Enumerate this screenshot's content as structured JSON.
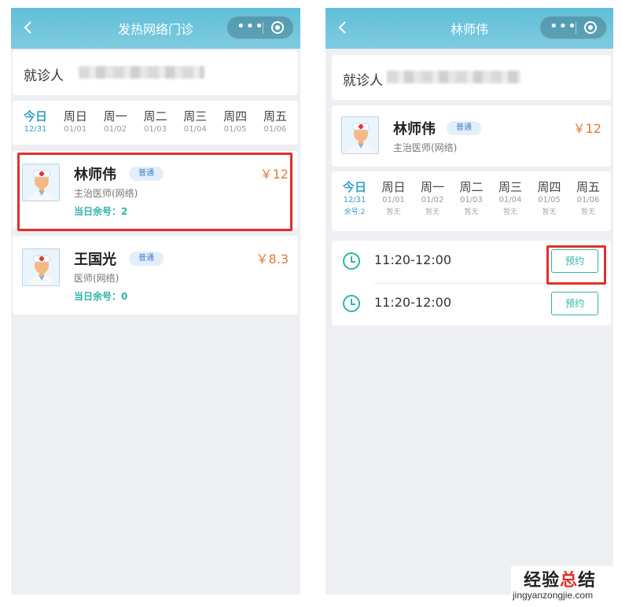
{
  "left": {
    "header": {
      "title": "发热网络门诊",
      "more_label": "•••"
    },
    "patient": {
      "label": "就诊人"
    },
    "dates": [
      {
        "day": "今日",
        "date": "12/31"
      },
      {
        "day": "周日",
        "date": "01/01"
      },
      {
        "day": "周一",
        "date": "01/02"
      },
      {
        "day": "周二",
        "date": "01/03"
      },
      {
        "day": "周三",
        "date": "01/04"
      },
      {
        "day": "周四",
        "date": "01/05"
      },
      {
        "day": "周五",
        "date": "01/06"
      }
    ],
    "doctors": [
      {
        "name": "林师伟",
        "badge": "普通",
        "title": "主治医师(网络)",
        "remaining": "当日余号：2",
        "price": "￥12"
      },
      {
        "name": "王国光",
        "badge": "普通",
        "title": "医师(网络)",
        "remaining": "当日余号：0",
        "price": "￥8.3"
      }
    ]
  },
  "right": {
    "header": {
      "title": "林师伟",
      "more_label": "•••"
    },
    "patient": {
      "label": "就诊人"
    },
    "doctor": {
      "name": "林师伟",
      "badge": "普通",
      "title": "主治医师(网络)",
      "price": "￥12"
    },
    "dates": [
      {
        "day": "今日",
        "date": "12/31",
        "remaining": "余号:2"
      },
      {
        "day": "周日",
        "date": "01/01",
        "remaining": "暂无"
      },
      {
        "day": "周一",
        "date": "01/02",
        "remaining": "暂无"
      },
      {
        "day": "周二",
        "date": "01/03",
        "remaining": "暂无"
      },
      {
        "day": "周三",
        "date": "01/04",
        "remaining": "暂无"
      },
      {
        "day": "周四",
        "date": "01/05",
        "remaining": "暂无"
      },
      {
        "day": "周五",
        "date": "01/06",
        "remaining": "暂无"
      }
    ],
    "slots": [
      {
        "time": "11:20-12:00",
        "button": "预约"
      },
      {
        "time": "11:20-12:00",
        "button": "预约"
      }
    ]
  },
  "watermark": {
    "cn_a": "经验",
    "cn_b": "总",
    "cn_c": "结",
    "en": "jingyanzongjie.com"
  },
  "colors": {
    "header": "#5fbfd8",
    "accent": "#2fb3a8",
    "price": "#e07a34",
    "highlight": "#e0302f",
    "badge_bg": "#e3eefb"
  },
  "icons": {
    "back": "chevron-left-icon",
    "more": "more-dots-icon",
    "close": "target-close-icon",
    "clock": "clock-icon",
    "avatar": "doctor-avatar-icon"
  }
}
